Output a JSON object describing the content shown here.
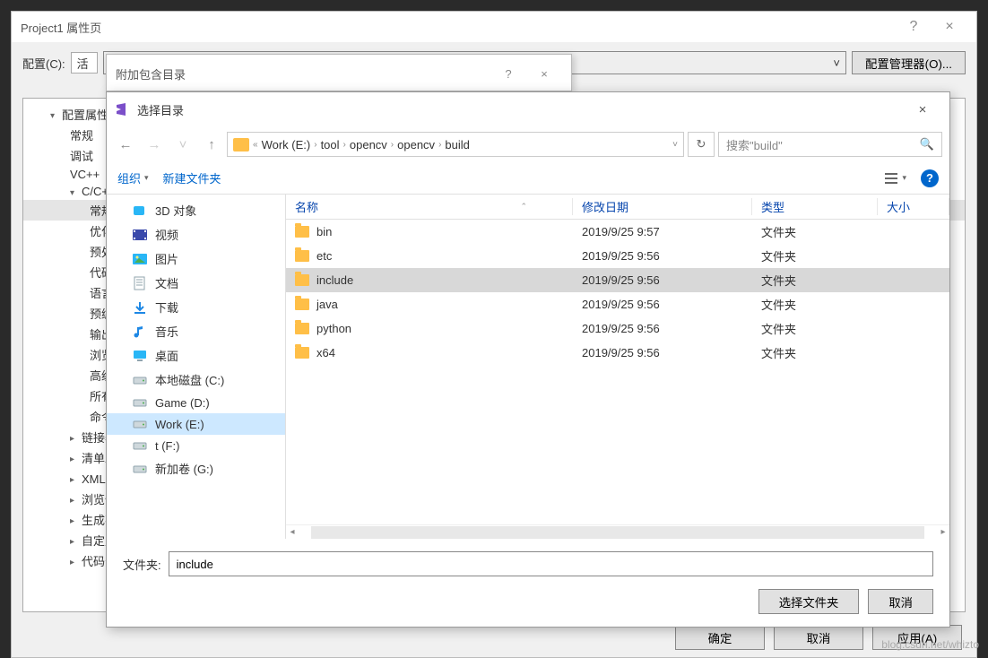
{
  "prop": {
    "title": "Project1 属性页",
    "config_label": "配置(C):",
    "config_value_prefix": "活",
    "config_mgr": "配置管理器(O)...",
    "tree": {
      "root": "配置属性",
      "items": [
        "常规",
        "调试",
        "VC++",
        "C/C++"
      ],
      "ccpp_children": [
        "常规",
        "优化",
        "预处",
        "代码",
        "语言",
        "预编",
        "输出",
        "浏览",
        "高级",
        "所有",
        "命令"
      ],
      "afterCcpp": [
        "链接器",
        "清单工",
        "XML 文",
        "浏览信息",
        "生成事件",
        "自定义生",
        "代码分析"
      ]
    },
    "ok": "确定",
    "cancel": "取消",
    "apply": "应用(A)"
  },
  "incdir": {
    "title": "附加包含目录",
    "help": "?",
    "close": "×"
  },
  "picker": {
    "title": "选择目录",
    "breadcrumb": [
      "Work (E:)",
      "tool",
      "opencv",
      "opencv",
      "build"
    ],
    "breadcrumb_prefix": "«",
    "search_placeholder": "搜索\"build\"",
    "toolbar": {
      "organize": "组织",
      "new_folder": "新建文件夹"
    },
    "nav_items": [
      {
        "label": "3D 对象",
        "icon": "3d"
      },
      {
        "label": "视频",
        "icon": "video"
      },
      {
        "label": "图片",
        "icon": "pic"
      },
      {
        "label": "文档",
        "icon": "doc"
      },
      {
        "label": "下载",
        "icon": "dl"
      },
      {
        "label": "音乐",
        "icon": "music"
      },
      {
        "label": "桌面",
        "icon": "desktop"
      },
      {
        "label": "本地磁盘 (C:)",
        "icon": "disk"
      },
      {
        "label": "Game (D:)",
        "icon": "disk"
      },
      {
        "label": "Work (E:)",
        "icon": "disk",
        "sel": true
      },
      {
        "label": "t (F:)",
        "icon": "disk"
      },
      {
        "label": "新加卷 (G:)",
        "icon": "disk"
      }
    ],
    "columns": {
      "name": "名称",
      "date": "修改日期",
      "type": "类型",
      "size": "大小"
    },
    "files": [
      {
        "name": "bin",
        "date": "2019/9/25 9:57",
        "type": "文件夹"
      },
      {
        "name": "etc",
        "date": "2019/9/25 9:56",
        "type": "文件夹"
      },
      {
        "name": "include",
        "date": "2019/9/25 9:56",
        "type": "文件夹",
        "sel": true
      },
      {
        "name": "java",
        "date": "2019/9/25 9:56",
        "type": "文件夹"
      },
      {
        "name": "python",
        "date": "2019/9/25 9:56",
        "type": "文件夹"
      },
      {
        "name": "x64",
        "date": "2019/9/25 9:56",
        "type": "文件夹"
      }
    ],
    "folder_label": "文件夹:",
    "folder_value": "include",
    "select_btn": "选择文件夹",
    "cancel_btn": "取消"
  },
  "watermark": "blog.csdn.net/whizto"
}
